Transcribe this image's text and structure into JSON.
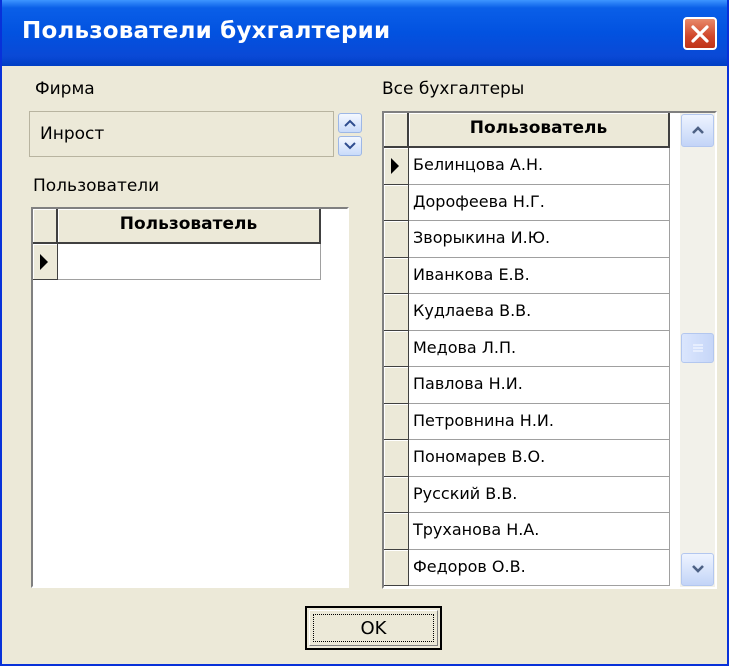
{
  "window": {
    "title": "Пользователи бухгалтерии"
  },
  "firm": {
    "label": "Фирма",
    "value": "Инрост"
  },
  "users": {
    "label": "Пользователи",
    "column": "Пользователь",
    "rows": [
      ""
    ]
  },
  "all": {
    "label": "Все бухгалтеры",
    "column": "Пользователь",
    "rows": [
      "Белинцова А.Н.",
      "Дорофеева Н.Г.",
      "Зворыкина И.Ю.",
      "Иванкова Е.В.",
      "Кудлаева В.В.",
      "Медова Л.П.",
      "Павлова Н.И.",
      "Петровнина Н.И.",
      "Пономарев В.О.",
      "Русский В.В.",
      "Труханова Н.А.",
      "Федоров О.В."
    ]
  },
  "ok_label": "OK",
  "colors": {
    "title_bar": "#0a5fe8",
    "window_bg": "#ece9d8",
    "close_button": "#d0462b"
  },
  "icons": [
    "close-icon",
    "arrow-up-icon",
    "arrow-down-icon",
    "row-pointer-icon",
    "scroll-up-icon",
    "scroll-down-icon"
  ]
}
